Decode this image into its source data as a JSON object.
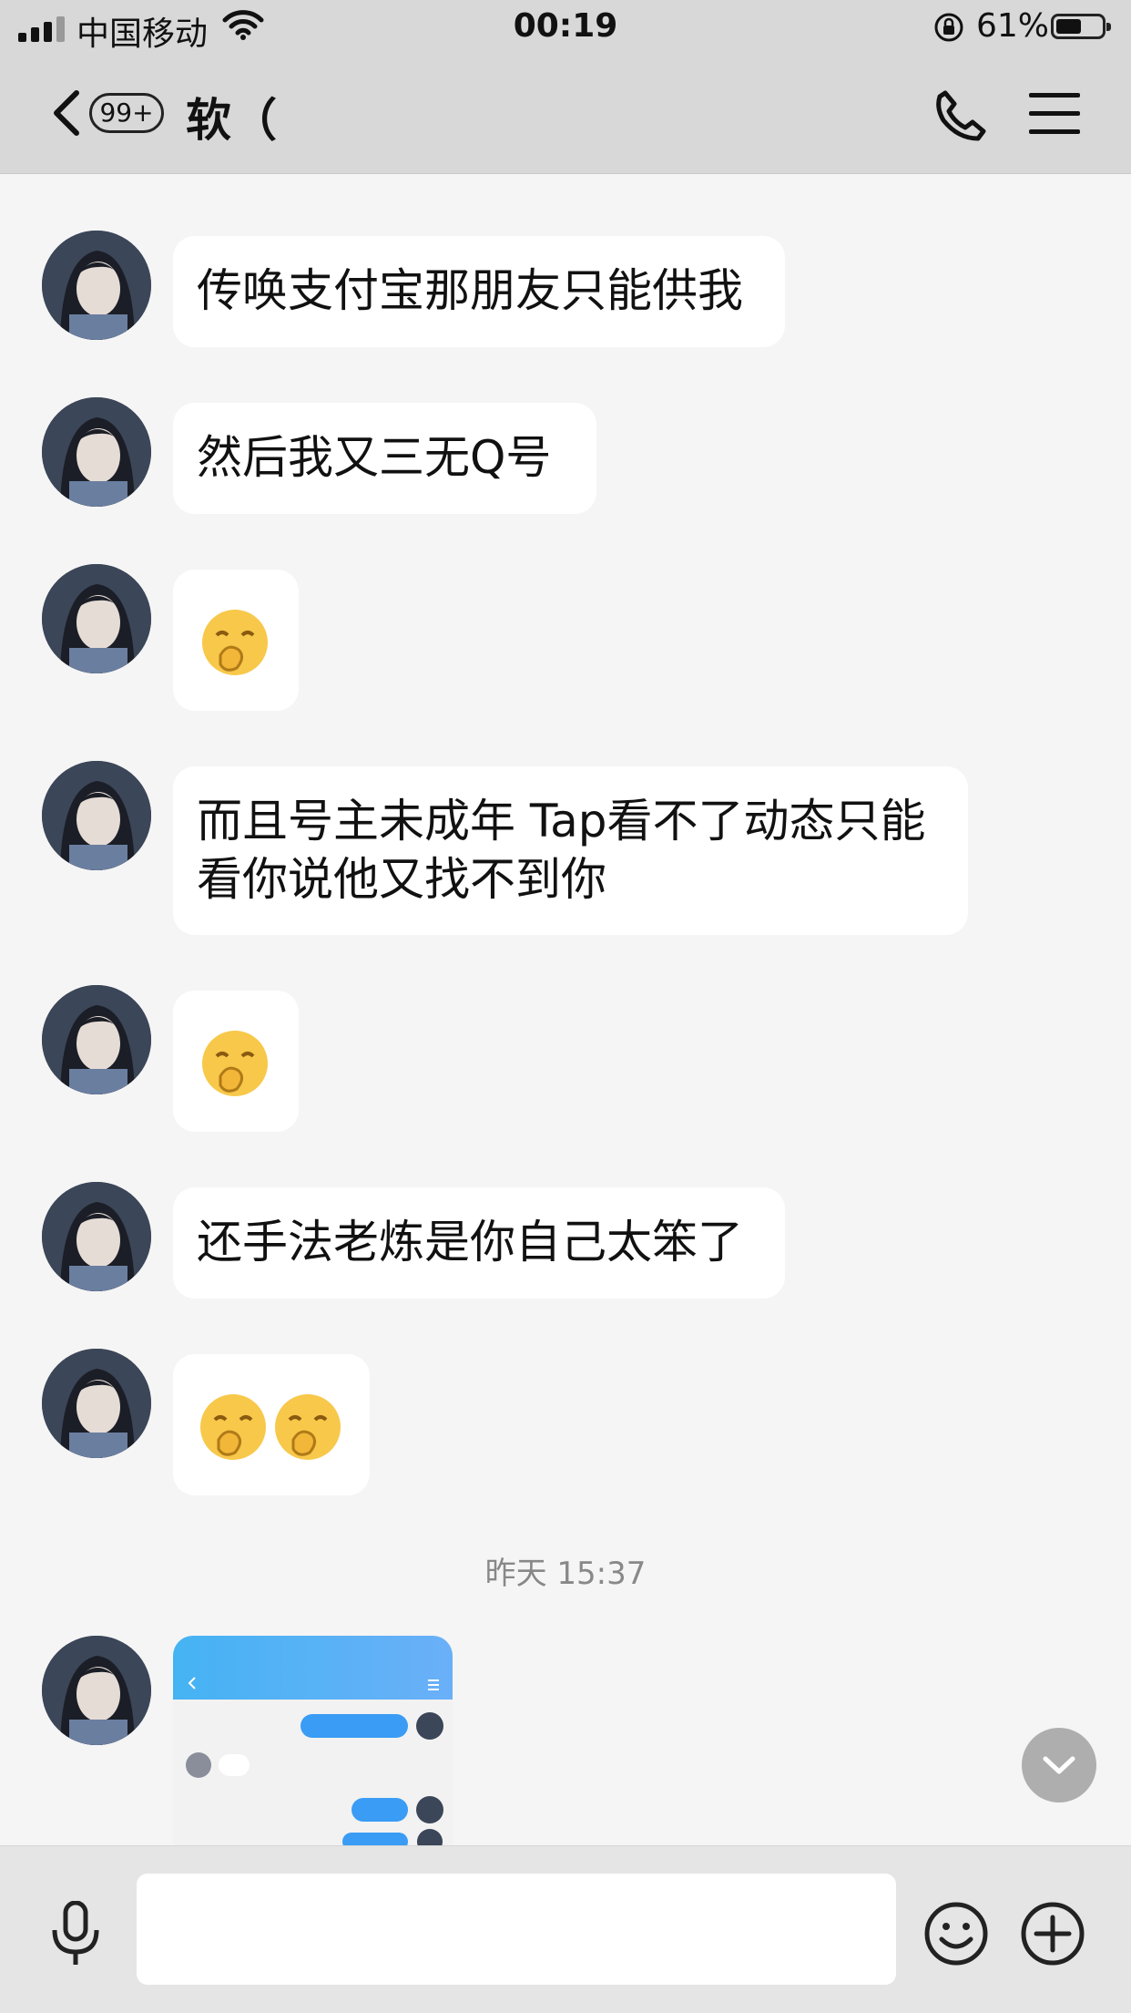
{
  "status_bar": {
    "carrier": "中国移动",
    "time": "00:19",
    "battery_percent": "61%",
    "battery_level": 0.61
  },
  "nav": {
    "unread_badge": "99+",
    "title": "软（"
  },
  "messages": [
    {
      "type": "text",
      "text": "传唤支付宝那朋友只能供我"
    },
    {
      "type": "text",
      "text": "然后我又三无Q号"
    },
    {
      "type": "emoji",
      "emoji": "🤭"
    },
    {
      "type": "text",
      "line1": "而且号主未成年 Tap看不了动态只能",
      "line2": "看你说他又找不到你"
    },
    {
      "type": "emoji",
      "emoji": "🤭"
    },
    {
      "type": "text",
      "text": "还手法老炼是你自己太笨了"
    },
    {
      "type": "emoji",
      "emoji": "🤭🤭"
    }
  ],
  "time_divider": "昨天 15:37",
  "colors": {
    "bar_bg": "#d8d8d8",
    "chat_bg": "#f5f5f5",
    "bubble_bg": "#ffffff",
    "qq_blue": "#3a9cf5"
  },
  "input": {
    "placeholder": ""
  }
}
